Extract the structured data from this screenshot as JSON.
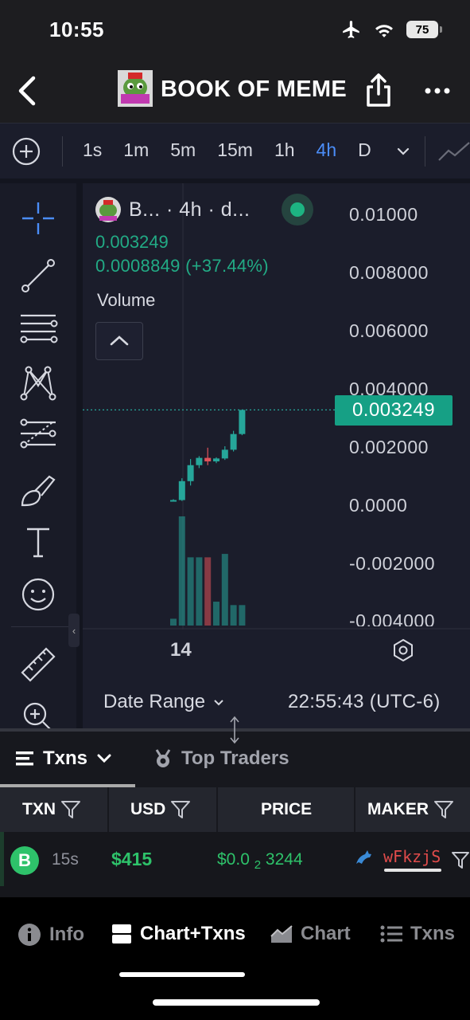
{
  "status_bar": {
    "time": "10:55",
    "battery": "75"
  },
  "header": {
    "title": "BOOK OF MEME"
  },
  "intervals": {
    "items": [
      "1s",
      "1m",
      "5m",
      "15m",
      "1h",
      "4h",
      "D"
    ],
    "active": "4h"
  },
  "legend": {
    "title": "B... · 4h · d...",
    "price": "0.003249",
    "change": "0.0008849 (+37.44%)",
    "volume_label": "Volume"
  },
  "chart_data": {
    "type": "candlestick",
    "y_axis_ticks": [
      "0.01000",
      "0.008000",
      "0.006000",
      "0.004000",
      "0.002000",
      "0.0000",
      "-0.002000",
      "-0.004000"
    ],
    "current_price_label": "0.003249",
    "x_axis_ticks": [
      "14"
    ],
    "ylim": [
      -0.004,
      0.01
    ],
    "candles": [
      {
        "open": 0.00013,
        "high": 0.00018,
        "low": 0.00011,
        "close": 0.00015,
        "volume": 2
      },
      {
        "open": 0.00015,
        "high": 0.0009,
        "low": 0.00012,
        "close": 0.0008,
        "volume": 32
      },
      {
        "open": 0.0008,
        "high": 0.00156,
        "low": 0.00065,
        "close": 0.00135,
        "volume": 20
      },
      {
        "open": 0.00135,
        "high": 0.00166,
        "low": 0.00125,
        "close": 0.0016,
        "volume": 20
      },
      {
        "open": 0.0016,
        "high": 0.00195,
        "low": 0.00135,
        "close": 0.00148,
        "volume": 20
      },
      {
        "open": 0.00148,
        "high": 0.00162,
        "low": 0.00142,
        "close": 0.00158,
        "volume": 7
      },
      {
        "open": 0.00158,
        "high": 0.002,
        "low": 0.00153,
        "close": 0.00188,
        "volume": 21
      },
      {
        "open": 0.00188,
        "high": 0.00253,
        "low": 0.00182,
        "close": 0.00242,
        "volume": 6
      },
      {
        "open": 0.00242,
        "high": 0.003249,
        "low": 0.00238,
        "close": 0.003249,
        "volume": 6
      }
    ]
  },
  "footer": {
    "date_range": "Date Range",
    "timezone": "22:55:43 (UTC-6)"
  },
  "panel_tabs": {
    "txns": "Txns",
    "top_traders": "Top Traders"
  },
  "columns": {
    "txn": "TXN",
    "usd": "USD",
    "price": "PRICE",
    "maker": "MAKER"
  },
  "transactions": [
    {
      "type": "B",
      "age": "15s",
      "usd": "$415",
      "price_prefix": "$0.0",
      "price_zeros": "2",
      "price_digits": "3244",
      "maker": "wFkzjS"
    }
  ],
  "bottom_nav": {
    "info": "Info",
    "chart_txns": "Chart+Txns",
    "chart": "Chart",
    "txns": "Txns"
  },
  "colors": {
    "up": "#26a69a",
    "down": "#e0525a",
    "accent": "#4b8df8",
    "buy": "#2ec26a",
    "sell": "#e04b4b"
  }
}
